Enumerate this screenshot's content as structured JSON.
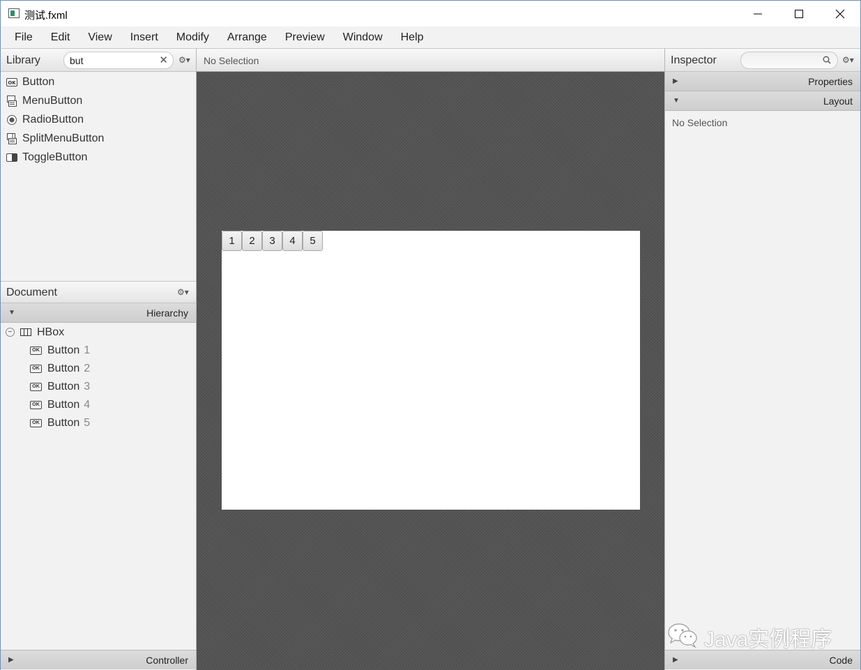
{
  "window": {
    "title": "测试.fxml"
  },
  "menu": [
    "File",
    "Edit",
    "View",
    "Insert",
    "Modify",
    "Arrange",
    "Preview",
    "Window",
    "Help"
  ],
  "library": {
    "title": "Library",
    "search_value": "but",
    "clear_glyph": "✕",
    "gear_glyph": "⚙▾",
    "items": [
      {
        "label": "Button",
        "icon": "button-icon"
      },
      {
        "label": "MenuButton",
        "icon": "menubutton-icon"
      },
      {
        "label": "RadioButton",
        "icon": "radiobutton-icon"
      },
      {
        "label": "SplitMenuButton",
        "icon": "splitmenubutton-icon"
      },
      {
        "label": "ToggleButton",
        "icon": "togglebutton-icon"
      }
    ]
  },
  "document": {
    "title": "Document",
    "gear_glyph": "⚙▾",
    "hierarchy_label": "Hierarchy",
    "hierarchy_arrow": "▼",
    "root": {
      "label": "HBox",
      "toggle": "−"
    },
    "children": [
      {
        "label": "Button",
        "num": "1"
      },
      {
        "label": "Button",
        "num": "2"
      },
      {
        "label": "Button",
        "num": "3"
      },
      {
        "label": "Button",
        "num": "4"
      },
      {
        "label": "Button",
        "num": "5"
      }
    ],
    "controller_label": "Controller",
    "controller_arrow": "▶"
  },
  "center": {
    "selection_text": "No Selection",
    "buttons": [
      "1",
      "2",
      "3",
      "4",
      "5"
    ]
  },
  "inspector": {
    "title": "Inspector",
    "search_value": "",
    "gear_glyph": "⚙▾",
    "properties_label": "Properties",
    "properties_arrow": "▶",
    "layout_label": "Layout",
    "layout_arrow": "▼",
    "selection_text": "No Selection",
    "code_label": "Code",
    "code_arrow": "▶"
  },
  "watermark": {
    "text": "Java实例程序"
  },
  "colors": {
    "window_border": "#6e8fb8",
    "canvas_background": "#535353",
    "panel_background": "#f2f2f2"
  }
}
